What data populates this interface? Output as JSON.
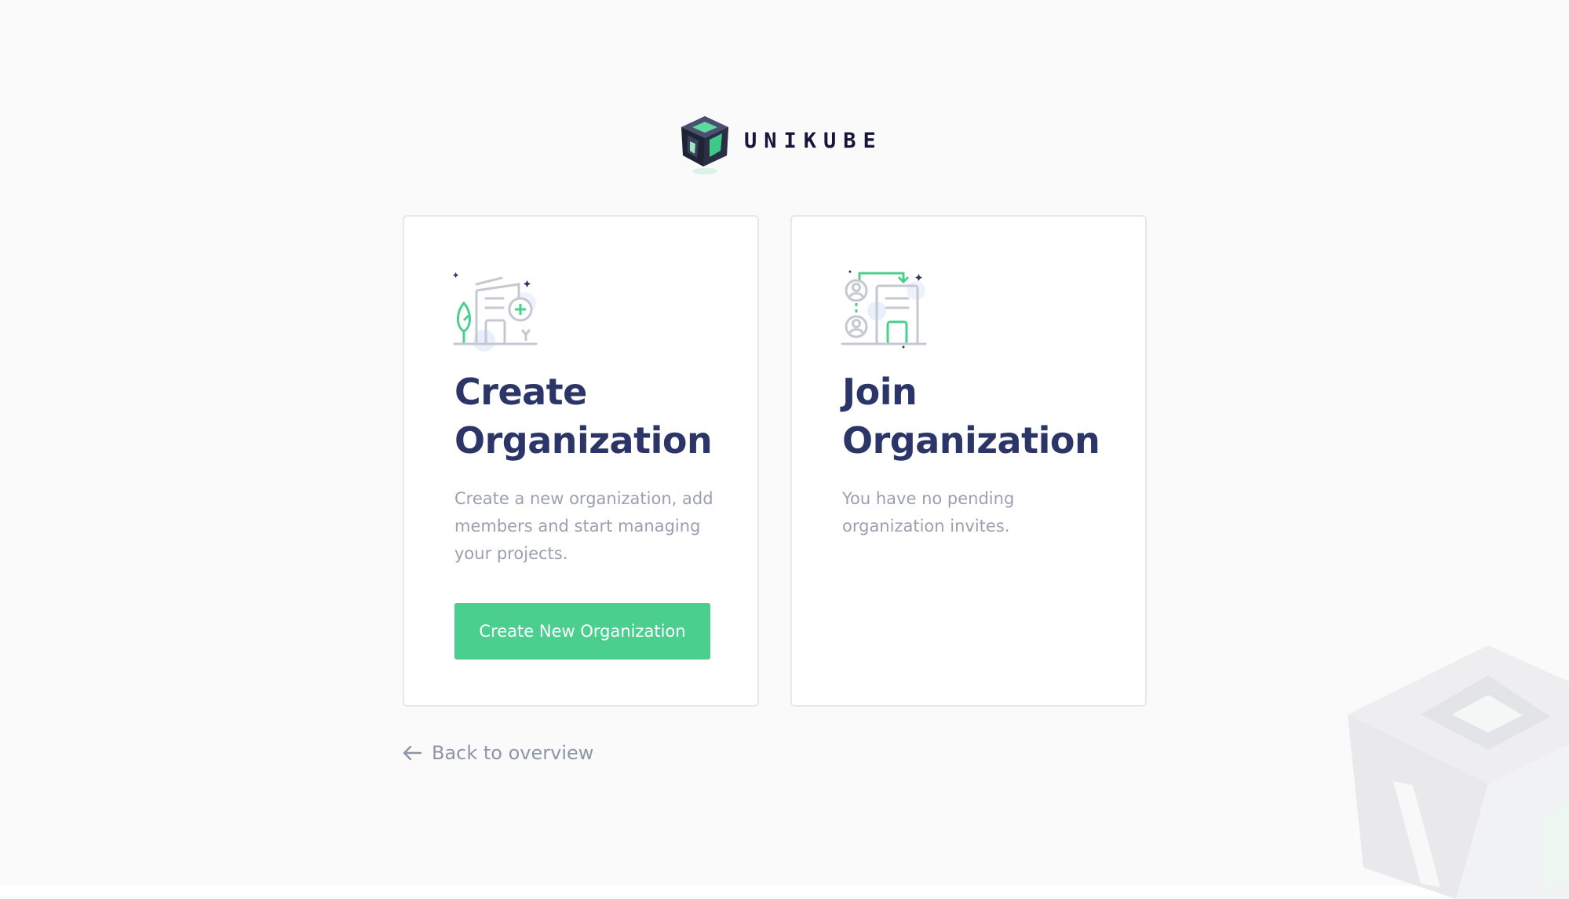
{
  "brand": {
    "name": "UNIKUBE"
  },
  "cards": {
    "create": {
      "title": "Create Organization",
      "description": "Create a new organization, add members and start managing your projects.",
      "button_label": "Create New Organization",
      "illustration": "building-add-icon"
    },
    "join": {
      "title": "Join Organization",
      "description": "You have no pending organization invites.",
      "illustration": "people-join-building-icon"
    }
  },
  "footer": {
    "back_label": "Back to overview",
    "back_icon": "arrow-left-icon"
  },
  "colors": {
    "accent": "#4acf8f",
    "heading": "#2c3568",
    "muted": "#9aa0ad",
    "brand_dark": "#15163a"
  }
}
